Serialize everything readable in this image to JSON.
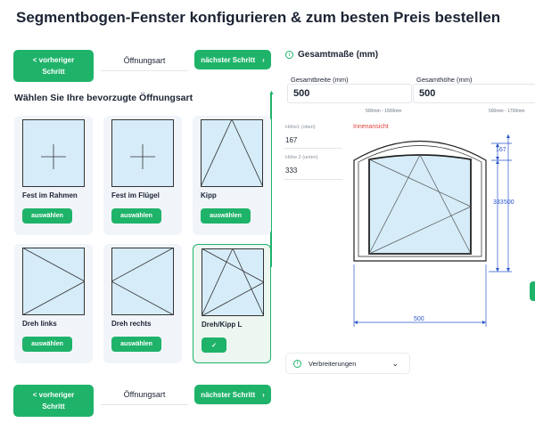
{
  "page": {
    "title": "Segmentbogen-Fenster konfigurieren & zum besten Preis bestellen"
  },
  "nav": {
    "prev_line1": "< vorheriger",
    "prev_line2": "Schritt",
    "step_name": "Öffnungsart",
    "next_label": "nächster Schritt",
    "next_icon": "chevron-right-icon"
  },
  "section": {
    "heading": "Wählen Sie Ihre bevorzugte Öffnungsart"
  },
  "options": [
    {
      "label": "Fest im Rahmen",
      "button": "auswählen",
      "type": "fixed-frame"
    },
    {
      "label": "Fest im Flügel",
      "button": "auswählen",
      "type": "fixed-sash"
    },
    {
      "label": "Kipp",
      "button": "auswählen",
      "type": "tilt"
    },
    {
      "label": "Dreh links",
      "button": "auswählen",
      "type": "turn-left"
    },
    {
      "label": "Dreh rechts",
      "button": "auswählen",
      "type": "turn-right"
    },
    {
      "label": "Dreh/Kipp L",
      "button": "✓",
      "type": "turn-tilt-left",
      "selected": true
    }
  ],
  "dimensions": {
    "heading": "Gesamtmaße (mm)",
    "width_label": "Gesamtbreite (mm)",
    "width_value": "500",
    "width_range": "500mm - 1500mm",
    "height_label": "Gesamthöhe (mm)",
    "height_value": "500",
    "height_range": "500mm - 1700mm",
    "h1_label": "Höhe1 (oben)",
    "h1_value": "167",
    "h2_label": "Höhe 2 (unten)",
    "h2_value": "333"
  },
  "drawing": {
    "view_label": "Innenansicht",
    "dim_top": "167",
    "dim_bottom": "333",
    "dim_total": "500",
    "dim_width": "500"
  },
  "extras": {
    "verbreiterungen": "Verbreiterungen"
  },
  "colors": {
    "accent": "#1fb36a",
    "glass": "#d6ecf9",
    "dim_line": "#2956c8",
    "view_label": "#e0453b"
  }
}
